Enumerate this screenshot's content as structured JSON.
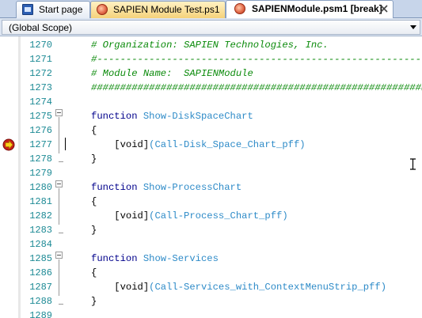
{
  "tabs": [
    {
      "label": "Start page",
      "icon": "start-page-icon",
      "active": false
    },
    {
      "label": "SAPIEN Module Test.ps1",
      "icon": "powershell-file-icon",
      "active": false
    },
    {
      "label": "SAPIENModule.psm1 [break]",
      "icon": "powershell-file-icon",
      "active": true
    }
  ],
  "scope": {
    "value": "(Global Scope)"
  },
  "editor": {
    "current_line": 1277,
    "lines": [
      {
        "num": "1270",
        "text": "# Organization: SAPIEN Technologies, Inc."
      },
      {
        "num": "1271",
        "text": "#------------------------------------------------------------"
      },
      {
        "num": "1272",
        "text": "# Module Name:  SAPIENModule"
      },
      {
        "num": "1273",
        "text": "##############################################################"
      },
      {
        "num": "1274",
        "text": ""
      },
      {
        "num": "1275",
        "kw": "function",
        "name": "Show-DiskSpaceChart"
      },
      {
        "num": "1276",
        "text": "{"
      },
      {
        "num": "1277",
        "type": "[void]",
        "call": "(Call-Disk_Space_Chart_pff)"
      },
      {
        "num": "1278",
        "text": "}"
      },
      {
        "num": "1279",
        "text": ""
      },
      {
        "num": "1280",
        "kw": "function",
        "name": "Show-ProcessChart"
      },
      {
        "num": "1281",
        "text": "{"
      },
      {
        "num": "1282",
        "type": "[void]",
        "call": "(Call-Process_Chart_pff)"
      },
      {
        "num": "1283",
        "text": "}"
      },
      {
        "num": "1284",
        "text": ""
      },
      {
        "num": "1285",
        "kw": "function",
        "name": "Show-Services"
      },
      {
        "num": "1286",
        "text": "{"
      },
      {
        "num": "1287",
        "type": "[void]",
        "call": "(Call-Services_with_ContextMenuStrip_pff)"
      },
      {
        "num": "1288",
        "text": "}"
      },
      {
        "num": "1289",
        "text": ""
      }
    ]
  },
  "colors": {
    "comment": "#0a8a0a",
    "keyword": "#00008b",
    "identifier": "#2e8bc8",
    "line_number": "#1d8a95"
  }
}
